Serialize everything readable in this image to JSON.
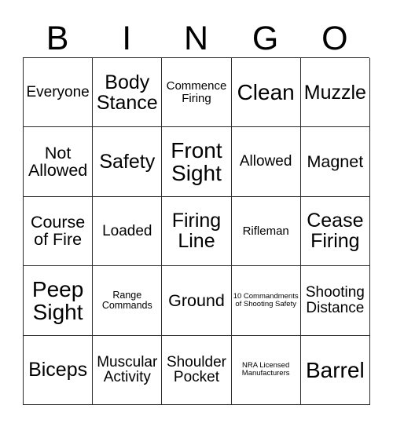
{
  "card": {
    "header_letters": [
      "B",
      "I",
      "N",
      "G",
      "O"
    ],
    "rows": [
      [
        {
          "text": "Everyone",
          "size": "m"
        },
        {
          "text": "Body Stance",
          "size": "xl"
        },
        {
          "text": "Commence Firing",
          "size": "s"
        },
        {
          "text": "Clean",
          "size": "xxl"
        },
        {
          "text": "Muzzle",
          "size": "xl"
        }
      ],
      [
        {
          "text": "Not Allowed",
          "size": "l"
        },
        {
          "text": "Safety",
          "size": "xl"
        },
        {
          "text": "Front Sight",
          "size": "xxl"
        },
        {
          "text": "Allowed",
          "size": "m"
        },
        {
          "text": "Magnet",
          "size": "l"
        }
      ],
      [
        {
          "text": "Course of Fire",
          "size": "l"
        },
        {
          "text": "Loaded",
          "size": "m"
        },
        {
          "text": "Firing Line",
          "size": "xl"
        },
        {
          "text": "Rifleman",
          "size": "s"
        },
        {
          "text": "Cease Firing",
          "size": "xl"
        }
      ],
      [
        {
          "text": "Peep Sight",
          "size": "xxl"
        },
        {
          "text": "Range Commands",
          "size": "xs"
        },
        {
          "text": "Ground",
          "size": "l"
        },
        {
          "text": "10 Commandments of Shooting Safety",
          "size": "xxs"
        },
        {
          "text": "Shooting Distance",
          "size": "m"
        }
      ],
      [
        {
          "text": "Biceps",
          "size": "xl"
        },
        {
          "text": "Muscular Activity",
          "size": "m"
        },
        {
          "text": "Shoulder Pocket",
          "size": "m"
        },
        {
          "text": "NRA Licensed Manufacturers",
          "size": "xxs"
        },
        {
          "text": "Barrel",
          "size": "xxl"
        }
      ]
    ]
  }
}
